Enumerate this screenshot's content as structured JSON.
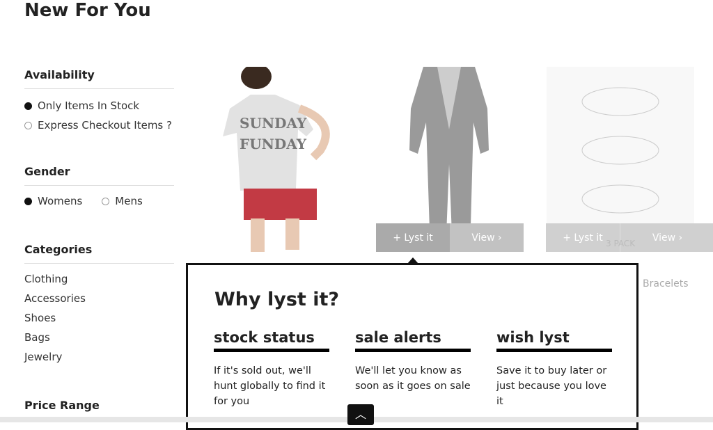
{
  "page_title": "New For You",
  "filters": {
    "availability": {
      "title": "Availability",
      "options": [
        {
          "label": "Only Items In Stock",
          "selected": true
        },
        {
          "label": "Express Checkout Items ?",
          "selected": false
        }
      ]
    },
    "gender": {
      "title": "Gender",
      "options": [
        {
          "label": "Womens",
          "selected": true
        },
        {
          "label": "Mens",
          "selected": false
        }
      ]
    },
    "categories": {
      "title": "Categories",
      "items": [
        "Clothing",
        "Accessories",
        "Shoes",
        "Bags",
        "Jewelry"
      ]
    },
    "price": {
      "title": "Price Range"
    }
  },
  "products": [
    {
      "image": "sunday-funday-tshirt",
      "print": "SUNDAY FUNDAY"
    },
    {
      "image": "black-jumpsuit",
      "lyst_label": "+  Lyst it",
      "view_label": "View  ›"
    },
    {
      "image": "bracelets-3-pack",
      "lyst_label": "+  Lyst it",
      "view_label": "View  ›",
      "overlay_text": "3 PACK",
      "category": "Bracelets"
    }
  ],
  "popup": {
    "title": "Why lyst it?",
    "columns": [
      {
        "heading": "stock status",
        "text": "If it's sold out, we'll hunt globally to find it for you"
      },
      {
        "heading": "sale alerts",
        "text": "We'll let you know as soon as it goes on sale"
      },
      {
        "heading": "wish lyst",
        "text": "Save it to buy later or just because you love it"
      }
    ]
  },
  "scroll_top_icon": "chevron-up-icon"
}
